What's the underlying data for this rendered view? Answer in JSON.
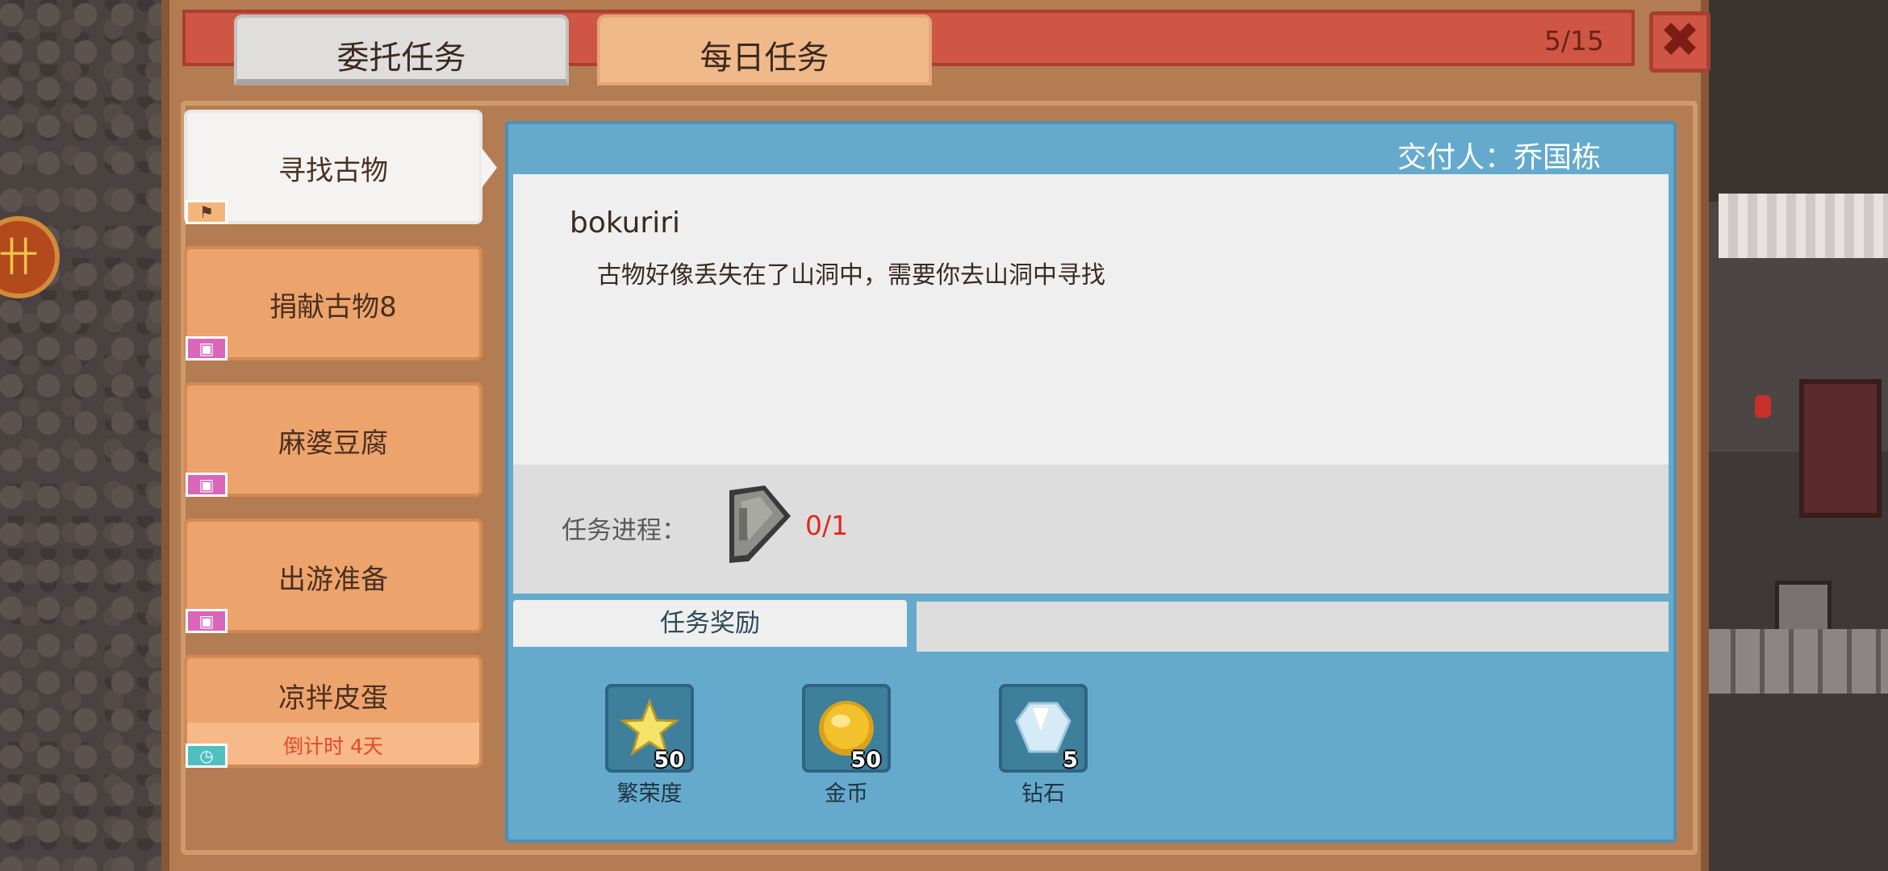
{
  "tabs": {
    "delegate_label": "委托任务",
    "daily_label": "每日任务"
  },
  "header": {
    "counter": "5/15",
    "close_glyph": "✖"
  },
  "quests": [
    {
      "label": "寻找古物",
      "tag": "flag",
      "active": true
    },
    {
      "label": "捐献古物8",
      "tag": "gift"
    },
    {
      "label": "麻婆豆腐",
      "tag": "gift"
    },
    {
      "label": "出游准备",
      "tag": "gift"
    },
    {
      "label": "凉拌皮蛋",
      "tag": "clock",
      "countdown": "倒计时 4天"
    }
  ],
  "detail": {
    "giver": "交付人：乔国栋",
    "name": "bokuriri",
    "description": "古物好像丢失在了山洞中，需要你去山洞中寻找",
    "progress_label": "任务进程：",
    "progress_value": "0/1",
    "progress_icon": "relic-fragment-icon",
    "reward_tab_label": "任务奖励"
  },
  "rewards": [
    {
      "name": "繁荣度",
      "count": "50",
      "icon": "star-icon",
      "color": "#f4e36a"
    },
    {
      "name": "金币",
      "count": "50",
      "icon": "gold-coin-icon",
      "color": "#f2c12c"
    },
    {
      "name": "钻石",
      "count": "5",
      "icon": "diamond-icon",
      "color": "#e6f2fb"
    }
  ],
  "colors": {
    "header_red": "#cf5645",
    "panel_brown": "#b47c52",
    "item_orange": "#eda36c",
    "detail_blue": "#65aacd",
    "progress_red": "#e02820"
  }
}
